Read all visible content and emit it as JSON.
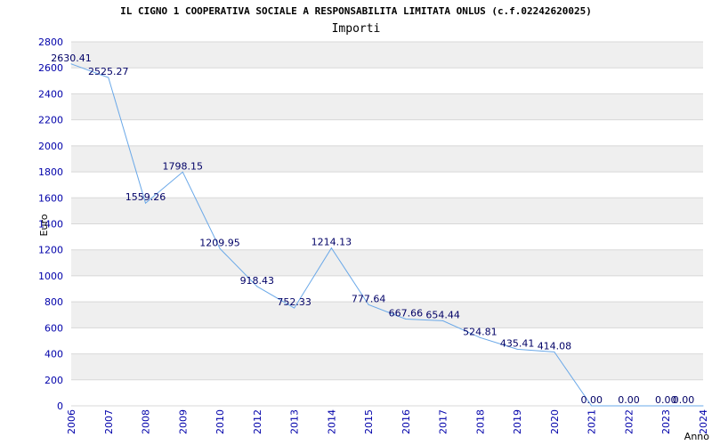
{
  "chart_data": {
    "type": "line",
    "title": "IL CIGNO 1 COOPERATIVA SOCIALE A RESPONSABILITA LIMITATA ONLUS (c.f.02242620025)",
    "subtitle": "Importi",
    "xlabel": "Anno",
    "ylabel": "Euro",
    "ylim": [
      0,
      2800
    ],
    "yticks": [
      0,
      200,
      400,
      600,
      800,
      1000,
      1200,
      1400,
      1600,
      1800,
      2000,
      2200,
      2400,
      2600,
      2800
    ],
    "categories": [
      "2006",
      "2007",
      "2008",
      "2009",
      "2010",
      "2012",
      "2013",
      "2014",
      "2015",
      "2016",
      "2017",
      "2018",
      "2019",
      "2020",
      "2021",
      "2022",
      "2023",
      "2024"
    ],
    "values": [
      2630.41,
      2525.27,
      1559.26,
      1798.15,
      1209.95,
      918.43,
      752.33,
      1214.13,
      777.64,
      667.66,
      654.44,
      524.81,
      435.41,
      414.08,
      0.0,
      0.0,
      0.0,
      0.0
    ],
    "value_labels": [
      "2630.41",
      "2525.27",
      "1559.26",
      "1798.15",
      "1209.95",
      "918.43",
      "752.33",
      "1214.13",
      "777.64",
      "667.66",
      "654.44",
      "524.81",
      "435.41",
      "414.08",
      "0.00",
      "0.00",
      "0.00",
      "0.00"
    ],
    "grid": true,
    "legend": "none",
    "colors": {
      "line": "#6aa8e8",
      "tick_text": "#0000aa",
      "label_text": "#000066",
      "band": "#efefef",
      "grid": "#d8d8d8"
    }
  }
}
